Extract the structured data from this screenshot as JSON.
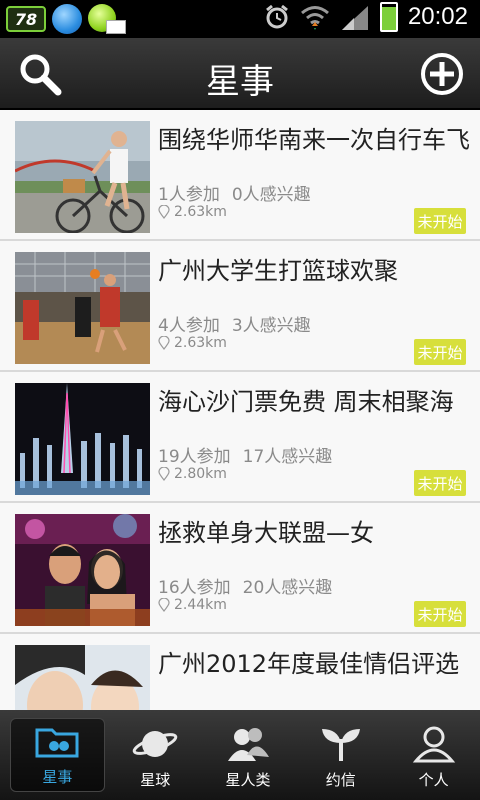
{
  "status_bar": {
    "notification_badge": "78",
    "time": "20:02"
  },
  "header": {
    "title": "星事"
  },
  "events": [
    {
      "title": "围绕华师华南来一次自行车飞",
      "joined": "1人参加",
      "interested": "0人感兴趣",
      "distance": "2.63km",
      "status": "未开始",
      "image": "cyclist-photo"
    },
    {
      "title": "广州大学生打篮球欢聚",
      "joined": "4人参加",
      "interested": "3人感兴趣",
      "distance": "2.63km",
      "status": "未开始",
      "image": "basketball-photo"
    },
    {
      "title": "海心沙门票免费 周末相聚海",
      "joined": "19人参加",
      "interested": "17人感兴趣",
      "distance": "2.80km",
      "status": "未开始",
      "image": "fountain-tower-photo"
    },
    {
      "title": "拯救单身大联盟—女",
      "joined": "16人参加",
      "interested": "20人感兴趣",
      "distance": "2.44km",
      "status": "未开始",
      "image": "party-photo"
    },
    {
      "title": "广州2012年度最佳情侣评选",
      "joined": "",
      "interested": "",
      "distance": "",
      "status": "",
      "image": "couple-photo"
    }
  ],
  "tabs": [
    {
      "label": "星事",
      "icon": "folder-icon",
      "active": true
    },
    {
      "label": "星球",
      "icon": "planet-icon",
      "active": false
    },
    {
      "label": "星人类",
      "icon": "people-icon",
      "active": false
    },
    {
      "label": "约信",
      "icon": "sprout-icon",
      "active": false
    },
    {
      "label": "个人",
      "icon": "person-icon",
      "active": false
    }
  ],
  "colors": {
    "badge": "#d7df3b",
    "active_tab": "#39a7e0",
    "header_bg": "#2a2a2a"
  }
}
